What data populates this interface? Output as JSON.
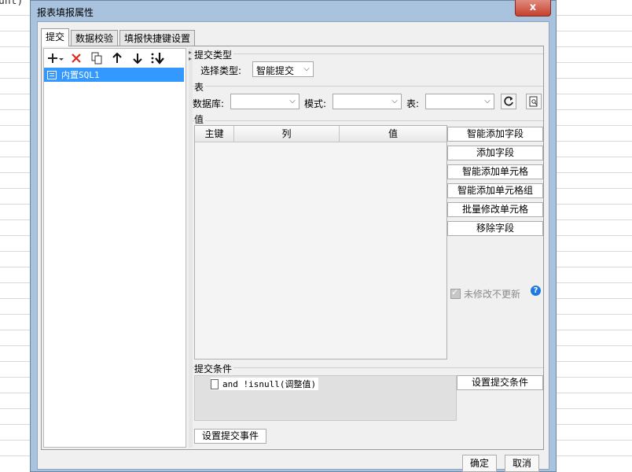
{
  "background": {
    "cell_text": "unt)"
  },
  "dialog": {
    "title": "报表填报属性",
    "close": "x",
    "tabs": [
      {
        "label": "提交"
      },
      {
        "label": "数据校验"
      },
      {
        "label": "填报快捷键设置"
      }
    ],
    "toolbar": [
      "add-icon",
      "delete-icon",
      "copy-icon",
      "move-up-icon",
      "move-down-icon",
      "move-bottom-icon"
    ],
    "tree": {
      "selected_item": "内置SQL1"
    },
    "submit_type": {
      "group": "提交类型",
      "label": "选择类型:",
      "value": "智能提交"
    },
    "table": {
      "group": "表",
      "db_label": "数据库:",
      "db_value": "",
      "schema_label": "模式:",
      "schema_value": "",
      "table_label": "表:",
      "table_value": ""
    },
    "values": {
      "group": "值",
      "columns": [
        "主键",
        "列",
        "值"
      ],
      "rows": [],
      "buttons": [
        "智能添加字段",
        "添加字段",
        "智能添加单元格",
        "智能添加单元格组",
        "批量修改单元格",
        "移除字段"
      ],
      "checkbox_label": "未修改不更新",
      "checkbox_checked": true,
      "help": "?"
    },
    "condition": {
      "group": "提交条件",
      "item": "and !isnull(调整值)",
      "button": "设置提交条件"
    },
    "event_button": "设置提交事件",
    "footer": {
      "ok": "确定",
      "cancel": "取消"
    }
  }
}
